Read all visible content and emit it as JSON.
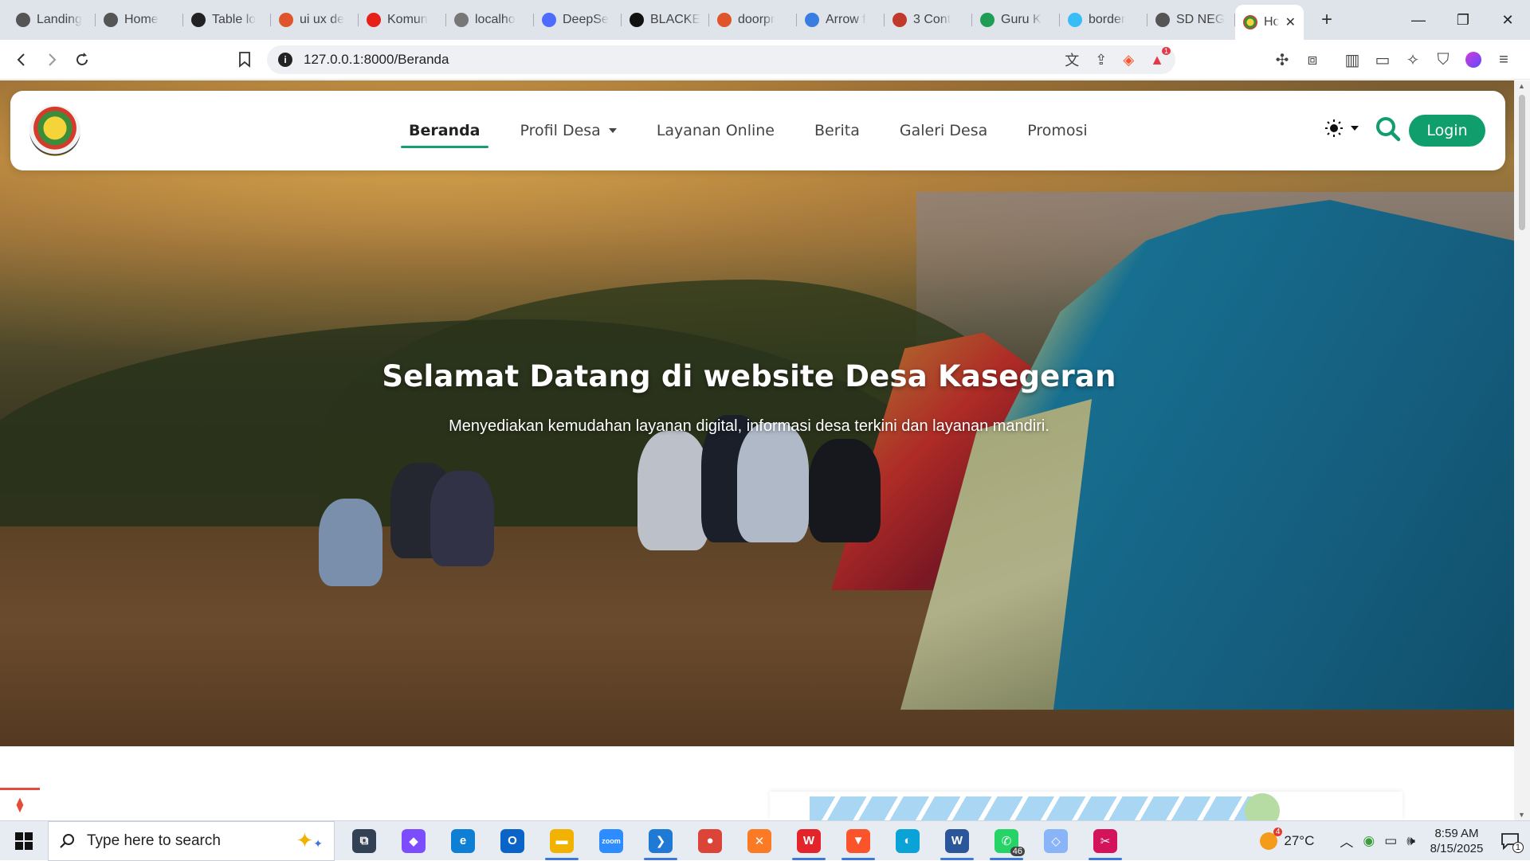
{
  "browser": {
    "tabs": [
      {
        "title": "Landing",
        "icon": "globe-icon",
        "color": "#555555"
      },
      {
        "title": "Home",
        "icon": "globe-icon",
        "color": "#555555"
      },
      {
        "title": "Table lo",
        "icon": "openai-icon",
        "color": "#222222"
      },
      {
        "title": "ui ux de",
        "icon": "brave-shield-icon",
        "color": "#e0542b"
      },
      {
        "title": "Komun",
        "icon": "youtube-icon",
        "color": "#e62117"
      },
      {
        "title": "localho",
        "icon": "globe-icon",
        "color": "#777777"
      },
      {
        "title": "DeepSe",
        "icon": "deepseek-icon",
        "color": "#4d6bfe"
      },
      {
        "title": "BLACKE",
        "icon": "black-circle-icon",
        "color": "#111111"
      },
      {
        "title": "doorpr",
        "icon": "brave-shield-icon",
        "color": "#e0542b"
      },
      {
        "title": "Arrow f",
        "icon": "arrow-app-icon",
        "color": "#3a7de0"
      },
      {
        "title": "3 Cont",
        "icon": "alert-icon",
        "color": "#c0392b"
      },
      {
        "title": "Guru K",
        "icon": "guru-icon",
        "color": "#1f9d55"
      },
      {
        "title": "border",
        "icon": "tailwind-icon",
        "color": "#38bdf8"
      },
      {
        "title": "SD NEG",
        "icon": "globe-icon",
        "color": "#555555"
      }
    ],
    "active_tab": {
      "title": "Ho",
      "icon": "village-logo-icon"
    },
    "new_tab_label": "+",
    "url": "127.0.0.1:8000/Beranda",
    "rewards_badge": "1"
  },
  "site": {
    "nav": {
      "items": [
        {
          "label": "Beranda",
          "active": true,
          "dropdown": false
        },
        {
          "label": "Profil Desa",
          "active": false,
          "dropdown": true
        },
        {
          "label": "Layanan Online",
          "active": false,
          "dropdown": false
        },
        {
          "label": "Berita",
          "active": false,
          "dropdown": false
        },
        {
          "label": "Galeri Desa",
          "active": false,
          "dropdown": false
        },
        {
          "label": "Promosi",
          "active": false,
          "dropdown": false
        }
      ],
      "login_label": "Login",
      "theme_icon": "sun-icon"
    },
    "hero": {
      "title": "Selamat Datang di website Desa Kasegeran",
      "subtitle": "Menyediakan kemudahan layanan digital, informasi desa terkini dan layanan mandiri."
    },
    "colors": {
      "accent": "#119e6d"
    }
  },
  "taskbar": {
    "search_placeholder": "Type here to search",
    "apps": [
      {
        "name": "task-view",
        "color": "#334155",
        "label": "⧉",
        "running": false
      },
      {
        "name": "copilot",
        "color": "#7c4dff",
        "label": "◆",
        "running": false
      },
      {
        "name": "edge",
        "color": "#0f7fd6",
        "label": "e",
        "running": false
      },
      {
        "name": "outlook",
        "color": "#0a64c8",
        "label": "O",
        "running": false
      },
      {
        "name": "file-explorer",
        "color": "#f2b300",
        "label": "▬",
        "running": true
      },
      {
        "name": "zoom",
        "color": "#2d8cff",
        "label": "zoom",
        "running": false
      },
      {
        "name": "vscode",
        "color": "#1f7ad6",
        "label": "❯",
        "running": true
      },
      {
        "name": "chrome",
        "color": "#db4437",
        "label": "●",
        "running": false
      },
      {
        "name": "xampp",
        "color": "#fb7a24",
        "label": "✕",
        "running": false
      },
      {
        "name": "wps-office",
        "color": "#e3242b",
        "label": "W",
        "running": true
      },
      {
        "name": "brave",
        "color": "#fb542b",
        "label": "▼",
        "running": true
      },
      {
        "name": "edge-dev",
        "color": "#0aa3d8",
        "label": "◐",
        "running": false
      },
      {
        "name": "word",
        "color": "#2b579a",
        "label": "W",
        "running": true
      },
      {
        "name": "whatsapp",
        "color": "#25d366",
        "label": "✆",
        "running": true,
        "badge": "46"
      },
      {
        "name": "git-app",
        "color": "#8ab4f8",
        "label": "◇",
        "running": false
      },
      {
        "name": "snipping-tool",
        "color": "#d4145a",
        "label": "✂",
        "running": true
      }
    ],
    "weather": {
      "temp": "27°C",
      "badge": "4"
    },
    "clock": {
      "time": "8:59 AM",
      "date": "8/15/2025"
    },
    "notification_count": "1"
  }
}
